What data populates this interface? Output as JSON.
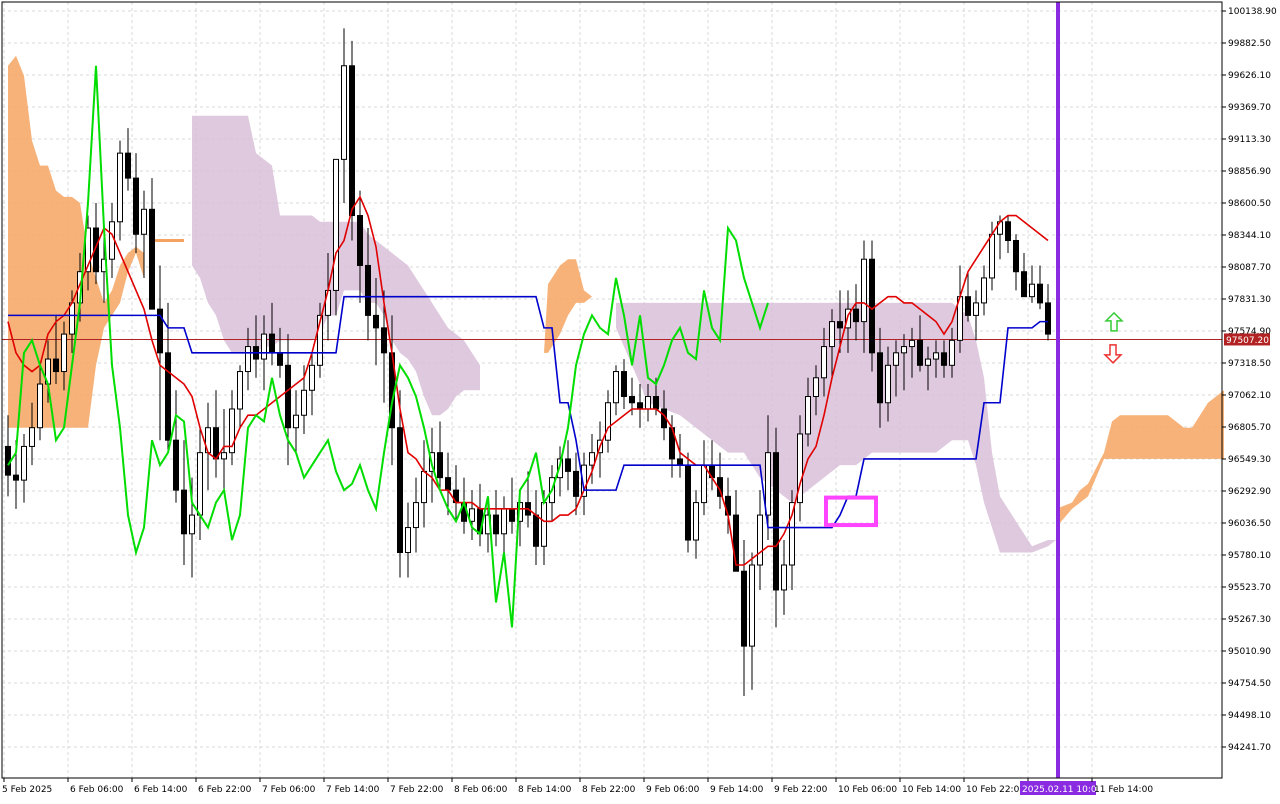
{
  "chart_data": {
    "type": "candlestick",
    "title": "",
    "xlabel": "",
    "ylabel": "",
    "ylim": [
      94000,
      100200
    ],
    "grid": true,
    "y_ticks": [
      100138.9,
      99882.5,
      99626.1,
      99369.7,
      99113.3,
      98856.9,
      98600.5,
      98344.1,
      98087.7,
      97831.3,
      97574.9,
      97318.5,
      97062.1,
      96805.7,
      96549.3,
      96292.9,
      96036.5,
      95780.1,
      95523.7,
      95267.3,
      95010.9,
      94754.5,
      94498.1,
      94241.7
    ],
    "y_tick_labels": [
      "100138.90",
      "99882.50",
      "99626.10",
      "99369.70",
      "99113.30",
      "98856.90",
      "98600.50",
      "98344.10",
      "98087.70",
      "97831.30",
      "97574.90",
      "97318.50",
      "97062.10",
      "96805.70",
      "96549.30",
      "96292.90",
      "96036.50",
      "95780.10",
      "95523.70",
      "95267.30",
      "95010.90",
      "94754.50",
      "94498.10",
      "94241.70"
    ],
    "x_labels": [
      "5 Feb 2025",
      "6 Feb 06:00",
      "6 Feb 14:00",
      "6 Feb 22:00",
      "7 Feb 06:00",
      "7 Feb 14:00",
      "7 Feb 22:00",
      "8 Feb 06:00",
      "8 Feb 14:00",
      "8 Feb 22:00",
      "9 Feb 06:00",
      "9 Feb 14:00",
      "9 Feb 22:00",
      "10 Feb 06:00",
      "10 Feb 14:00",
      "10 Feb 22:00",
      "2025.02.11 10:00",
      "11 Feb 14:00"
    ],
    "current_price": 97507.2,
    "current_price_label": "97507.20",
    "current_price_color": "#b22222",
    "highlight_time_label": "2025.02.11 10:00",
    "highlight_color": "#8a2be2",
    "colors": {
      "tenkan": "#e00000",
      "kijun": "#0000cc",
      "chikou": "#00dd00",
      "kumo_bull": "#f4a460",
      "kumo_bear": "#d8bfd8",
      "bull_candle": "#ffffff",
      "bear_candle": "#000000",
      "box": "#ff44ff",
      "arrow_up": "#33cc33",
      "arrow_down": "#ee3333"
    },
    "arrow_up_icon": "arrow-up-icon",
    "arrow_down_icon": "arrow-down-icon",
    "candles": [
      [
        96650,
        96900,
        96250,
        96420
      ],
      [
        96420,
        96700,
        96150,
        96380
      ],
      [
        96380,
        96750,
        96200,
        96650
      ],
      [
        96650,
        97000,
        96500,
        96800
      ],
      [
        96800,
        97300,
        96700,
        97150
      ],
      [
        97150,
        97500,
        97000,
        97350
      ],
      [
        97350,
        97700,
        97150,
        97250
      ],
      [
        97250,
        97650,
        97100,
        97550
      ],
      [
        97550,
        97900,
        97400,
        97800
      ],
      [
        97800,
        98200,
        97650,
        98050
      ],
      [
        98050,
        98500,
        97900,
        98400
      ],
      [
        98400,
        98600,
        97950,
        98050
      ],
      [
        98050,
        98350,
        97800,
        98150
      ],
      [
        98150,
        98600,
        98000,
        98450
      ],
      [
        98450,
        99100,
        98300,
        99000
      ],
      [
        99000,
        99200,
        98700,
        98800
      ],
      [
        98800,
        99000,
        98200,
        98350
      ],
      [
        98350,
        98700,
        98000,
        98550
      ],
      [
        98550,
        98800,
        97900,
        97750
      ],
      [
        97750,
        98100,
        96700,
        97400
      ],
      [
        97400,
        97800,
        96600,
        96700
      ],
      [
        96700,
        97100,
        96200,
        96300
      ],
      [
        96300,
        96700,
        95700,
        95950
      ],
      [
        95950,
        96400,
        95600,
        96100
      ],
      [
        96100,
        96800,
        95900,
        96600
      ],
      [
        96600,
        97000,
        96300,
        96800
      ],
      [
        96800,
        97100,
        96400,
        96550
      ],
      [
        96550,
        96950,
        96300,
        96600
      ],
      [
        96600,
        97100,
        96500,
        96950
      ],
      [
        96950,
        97300,
        96800,
        97250
      ],
      [
        97250,
        97600,
        97100,
        97450
      ],
      [
        97450,
        97700,
        97200,
        97350
      ],
      [
        97350,
        97700,
        97100,
        97550
      ],
      [
        97550,
        97800,
        97300,
        97400
      ],
      [
        97400,
        97600,
        97200,
        97300
      ],
      [
        97300,
        97550,
        96500,
        96800
      ],
      [
        96800,
        97100,
        96600,
        96900
      ],
      [
        96900,
        97300,
        96750,
        97100
      ],
      [
        97100,
        97400,
        96900,
        97300
      ],
      [
        97300,
        97800,
        97200,
        97700
      ],
      [
        97700,
        98200,
        97500,
        97900
      ],
      [
        97900,
        98500,
        97700,
        98950
      ],
      [
        98950,
        100000,
        98600,
        99700
      ],
      [
        99700,
        99900,
        98300,
        98500
      ],
      [
        98500,
        98700,
        97800,
        98100
      ],
      [
        98100,
        98400,
        97500,
        97700
      ],
      [
        97700,
        98000,
        97300,
        97600
      ],
      [
        97600,
        97900,
        97000,
        97400
      ],
      [
        97400,
        97700,
        96500,
        96800
      ],
      [
        96800,
        97100,
        95600,
        95800
      ],
      [
        95800,
        96200,
        95600,
        96000
      ],
      [
        96000,
        96400,
        95800,
        96200
      ],
      [
        96200,
        96700,
        96000,
        96450
      ],
      [
        96450,
        96800,
        96200,
        96600
      ],
      [
        96600,
        96850,
        96300,
        96400
      ],
      [
        96400,
        96600,
        96100,
        96300
      ],
      [
        96300,
        96500,
        96050,
        96200
      ],
      [
        96200,
        96400,
        95950,
        96050
      ],
      [
        96050,
        96300,
        95900,
        96150
      ],
      [
        96150,
        96350,
        95850,
        95950
      ],
      [
        95950,
        96200,
        95800,
        96100
      ],
      [
        96100,
        96300,
        95850,
        95950
      ],
      [
        95950,
        96250,
        95800,
        96150
      ],
      [
        96150,
        96400,
        95950,
        96050
      ],
      [
        96050,
        96300,
        95850,
        96200
      ],
      [
        96200,
        96450,
        96000,
        96100
      ],
      [
        96100,
        96300,
        95700,
        95850
      ],
      [
        95850,
        96300,
        95700,
        96200
      ],
      [
        96200,
        96500,
        96050,
        96400
      ],
      [
        96400,
        96650,
        96250,
        96550
      ],
      [
        96550,
        96700,
        96300,
        96450
      ],
      [
        96450,
        96600,
        96100,
        96250
      ],
      [
        96250,
        96600,
        96100,
        96500
      ],
      [
        96500,
        96750,
        96350,
        96600
      ],
      [
        96600,
        96850,
        96400,
        96700
      ],
      [
        96700,
        97100,
        96600,
        97000
      ],
      [
        97000,
        97300,
        96900,
        97250
      ],
      [
        97250,
        97350,
        96950,
        97050
      ],
      [
        97050,
        97200,
        96900,
        97000
      ],
      [
        97000,
        97150,
        96800,
        96950
      ],
      [
        96950,
        97150,
        96850,
        97050
      ],
      [
        97050,
        97200,
        96900,
        96950
      ],
      [
        96950,
        97100,
        96700,
        96800
      ],
      [
        96800,
        96900,
        96400,
        96550
      ],
      [
        96550,
        96750,
        96400,
        96500
      ],
      [
        96500,
        96600,
        95800,
        95900
      ],
      [
        95900,
        96300,
        95750,
        96200
      ],
      [
        96200,
        96700,
        96100,
        96500
      ],
      [
        96500,
        96700,
        96300,
        96400
      ],
      [
        96400,
        96600,
        96150,
        96250
      ],
      [
        96250,
        96400,
        95950,
        96100
      ],
      [
        96100,
        96300,
        95700,
        95650
      ],
      [
        95650,
        95900,
        94650,
        95050
      ],
      [
        95050,
        95800,
        94700,
        95700
      ],
      [
        95700,
        96300,
        95500,
        96100
      ],
      [
        96100,
        96900,
        95900,
        96600
      ],
      [
        96600,
        96800,
        95200,
        95500
      ],
      [
        95500,
        95900,
        95300,
        95700
      ],
      [
        95700,
        96300,
        95500,
        96200
      ],
      [
        96200,
        96900,
        96050,
        96750
      ],
      [
        96750,
        97200,
        96650,
        97050
      ],
      [
        97050,
        97300,
        96900,
        97200
      ],
      [
        97200,
        97600,
        97050,
        97450
      ],
      [
        97450,
        97750,
        97200,
        97650
      ],
      [
        97650,
        97900,
        97400,
        97600
      ],
      [
        97600,
        97900,
        97400,
        97750
      ],
      [
        97750,
        97950,
        97500,
        97650
      ],
      [
        97650,
        98300,
        97400,
        98150
      ],
      [
        98150,
        98300,
        97250,
        97400
      ],
      [
        97400,
        97600,
        96800,
        97000
      ],
      [
        97000,
        97450,
        96850,
        97300
      ],
      [
        97300,
        97500,
        97050,
        97400
      ],
      [
        97400,
        97550,
        97100,
        97450
      ],
      [
        97450,
        97600,
        97200,
        97500
      ],
      [
        97500,
        97700,
        97250,
        97300
      ],
      [
        97300,
        97450,
        97100,
        97350
      ],
      [
        97350,
        97500,
        97200,
        97400
      ],
      [
        97400,
        97500,
        97200,
        97300
      ],
      [
        97300,
        97600,
        97200,
        97500
      ],
      [
        97500,
        98100,
        97400,
        97850
      ],
      [
        97850,
        98050,
        97650,
        97700
      ],
      [
        97700,
        97900,
        97500,
        97800
      ],
      [
        97800,
        98100,
        97700,
        98000
      ],
      [
        98000,
        98450,
        97900,
        98350
      ],
      [
        98350,
        98500,
        98150,
        98450
      ],
      [
        98450,
        98500,
        98200,
        98300
      ],
      [
        98300,
        98350,
        97900,
        98050
      ],
      [
        98050,
        98200,
        97850,
        97850
      ],
      [
        97850,
        98100,
        97800,
        97950
      ],
      [
        97950,
        98100,
        97750,
        97800
      ],
      [
        97800,
        97950,
        97500,
        97550
      ]
    ]
  }
}
